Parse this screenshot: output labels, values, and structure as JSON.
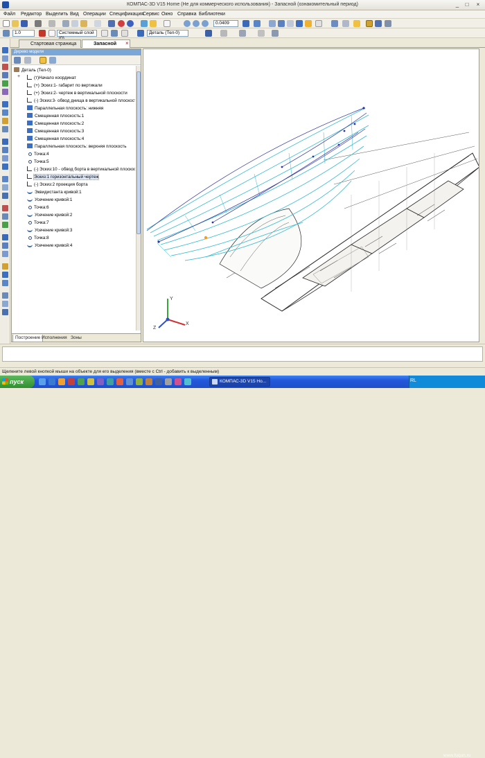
{
  "window": {
    "title": "КОМПАС-3D V15 Home (Не для коммерческого использования) - Запасной (ознакомительный период)"
  },
  "menu": [
    "Файл",
    "Редактор",
    "Выделить",
    "Вид",
    "Операции",
    "Спецификация",
    "Сервис",
    "Окно",
    "Справка",
    "Библиотеки"
  ],
  "toolbar": {
    "zoom_value": "0.0409",
    "scale_value": "1.0",
    "layer_value": "Системный слой (0)",
    "part_value": "Деталь (Тел-0)"
  },
  "doc_tabs": {
    "start": "Стартовая страница",
    "active": "Запасной"
  },
  "tree": {
    "header": "Дерево модели",
    "items": [
      {
        "label": "Деталь (Тел-0)",
        "type": "part",
        "level": 0
      },
      {
        "label": "(т)Начало координат",
        "type": "sketch",
        "level": 1
      },
      {
        "label": "(+) Эскиз:1- габарит по вертикали",
        "type": "sketch",
        "level": 1
      },
      {
        "label": "(+) Эскиз:2- чертеж в вертикальной плоскости",
        "type": "sketch",
        "level": 1
      },
      {
        "label": "(-) Эскиз:3- обвод днища в вертикальной плоскости",
        "type": "sketch",
        "level": 1
      },
      {
        "label": "Параллельная плоскость: нижняя",
        "type": "plane",
        "level": 1
      },
      {
        "label": "Смещенная плоскость:1",
        "type": "plane",
        "level": 1
      },
      {
        "label": "Смещенная плоскость:2",
        "type": "plane",
        "level": 1
      },
      {
        "label": "Смещенная плоскость:3",
        "type": "plane",
        "level": 1
      },
      {
        "label": "Смещенная плоскость:4",
        "type": "plane",
        "level": 1
      },
      {
        "label": "Параллельная плоскость: верхняя плоскость",
        "type": "plane",
        "level": 1
      },
      {
        "label": "Точка:4",
        "type": "point",
        "level": 1
      },
      {
        "label": "Точка:5",
        "type": "point",
        "level": 1
      },
      {
        "label": "(-) Эскиз:10 - обвод борта в вертикальной плоскост",
        "type": "sketch",
        "level": 1
      },
      {
        "label": "Эскиз:1 горизонтальный чертеж",
        "type": "sketch",
        "level": 1,
        "selected": true
      },
      {
        "label": "(-) Эскиз:2 проекция борта",
        "type": "sketch",
        "level": 1
      },
      {
        "label": "Эквидистанта кривой:1",
        "type": "curve",
        "level": 1
      },
      {
        "label": "Усечение кривой:1",
        "type": "curve",
        "level": 1
      },
      {
        "label": "Точка:6",
        "type": "point",
        "level": 1
      },
      {
        "label": "Усечение кривой:2",
        "type": "curve",
        "level": 1
      },
      {
        "label": "Точка:7",
        "type": "point",
        "level": 1
      },
      {
        "label": "Усечение кривой:3",
        "type": "curve",
        "level": 1
      },
      {
        "label": "Точка:8",
        "type": "point",
        "level": 1
      },
      {
        "label": "Усечение кривой:4",
        "type": "curve",
        "level": 1
      }
    ]
  },
  "panel_tabs": [
    "Построение",
    "Исполнения",
    "Зоны"
  ],
  "viewport": {
    "axis_x": "X",
    "axis_y": "Y",
    "axis_z": "Z"
  },
  "status": "Щелкните левой кнопкой мыши на объекте для его выделения (вместе с Ctrl - добавить к выделенным)",
  "taskbar": {
    "start": "пуск",
    "task_item": "КОМПАС-3D V15 Ho...",
    "lang": "RL",
    "watermark": "www.fuqun.ru"
  },
  "colors": {
    "taskbar": "#2157d9",
    "start_green": "#3c9a3c",
    "tree_header": "#7aa6d8",
    "wire": "#32b8d0",
    "drawing": "#2a2a2a"
  }
}
